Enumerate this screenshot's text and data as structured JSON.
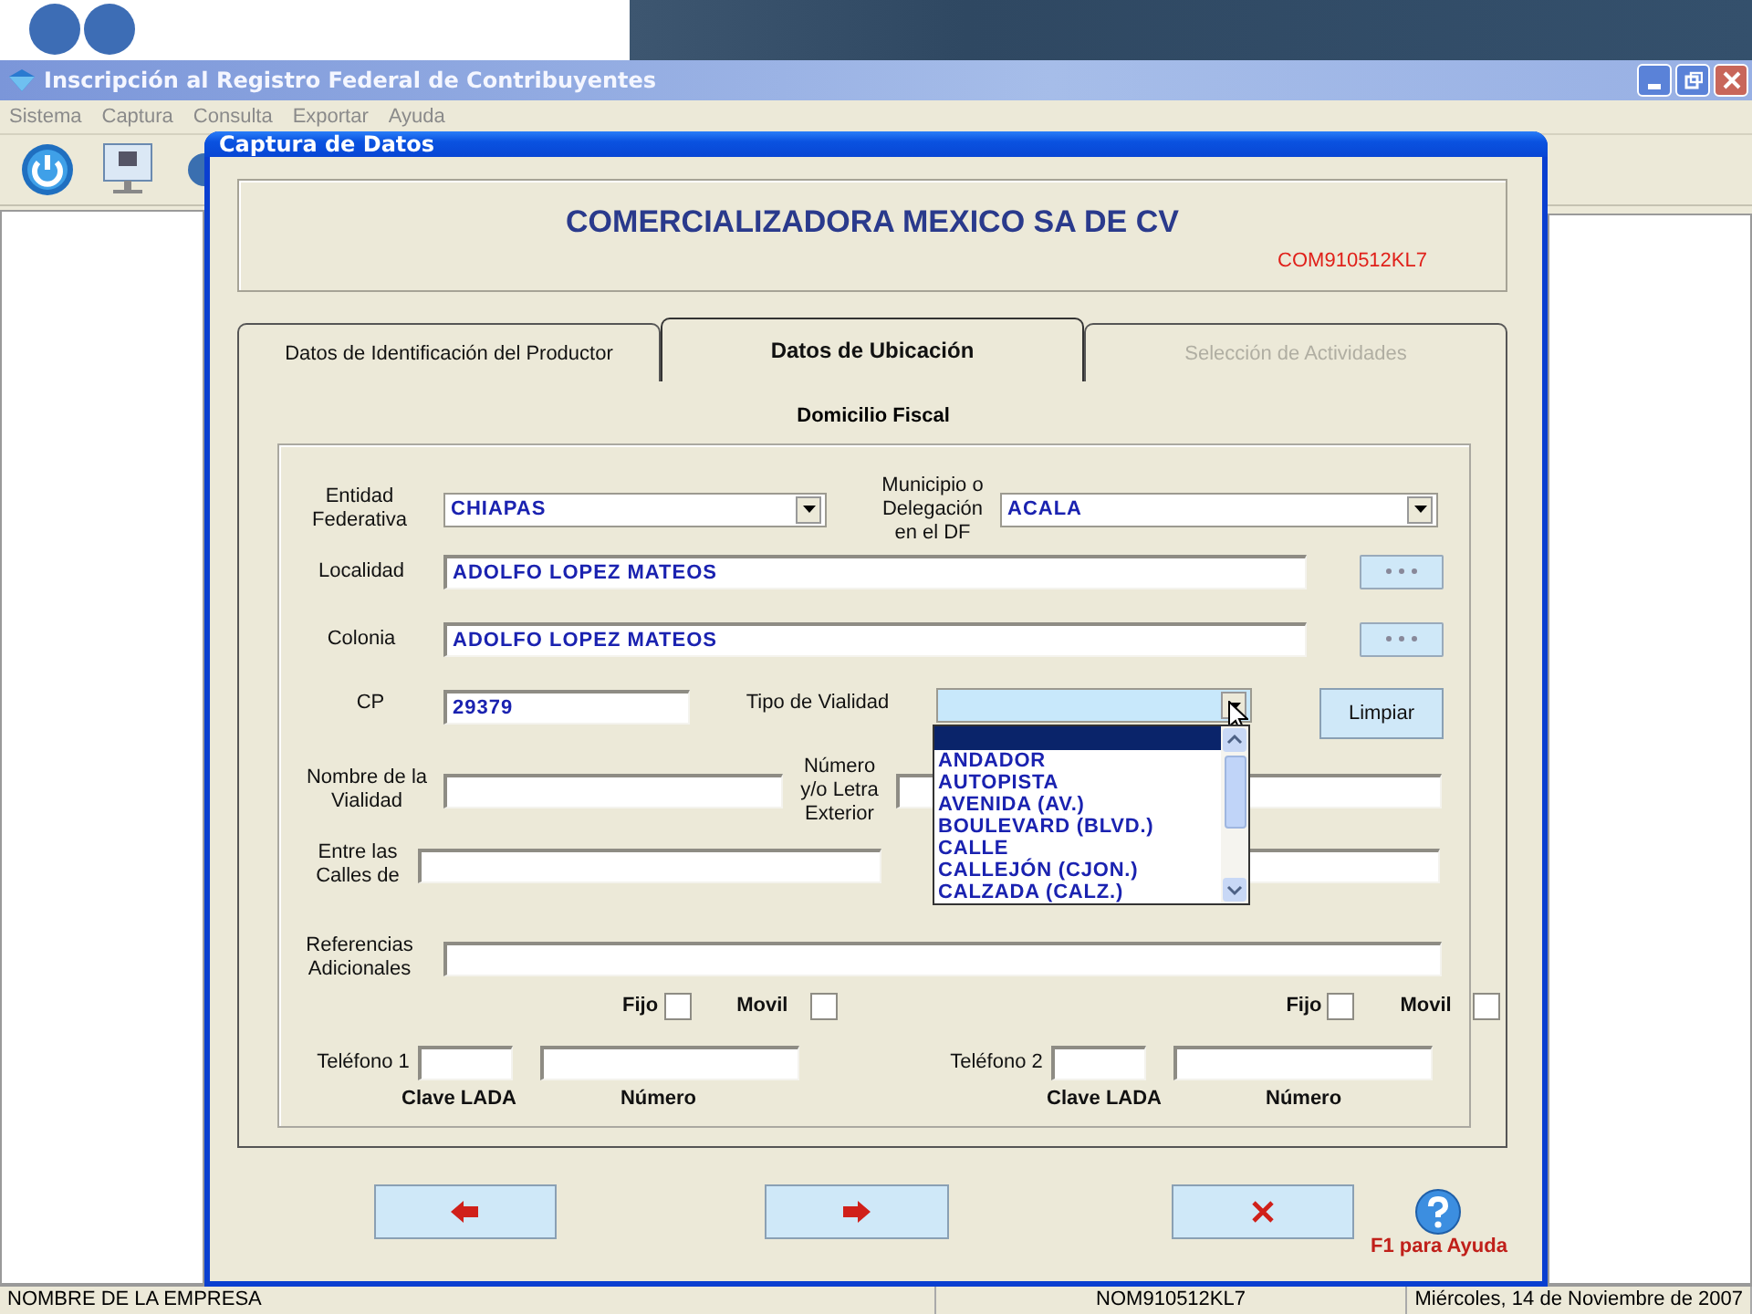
{
  "window": {
    "title": "Inscripción al Registro Federal de Contribuyentes"
  },
  "menu": [
    {
      "label": "Sistema",
      "disabled": true
    },
    {
      "label": "Captura",
      "disabled": true
    },
    {
      "label": "Consulta",
      "disabled": true
    },
    {
      "label": "Exportar",
      "disabled": true
    },
    {
      "label": "Ayuda",
      "disabled": true
    }
  ],
  "dialog": {
    "title": "Captura de Datos",
    "company": "COMERCIALIZADORA MEXICO SA DE CV",
    "rfc": "COM910512KL7",
    "tabs": [
      {
        "label": "Datos de Identificación del Productor",
        "selected": false,
        "disabled": false
      },
      {
        "label": "Datos de Ubicación",
        "selected": true,
        "disabled": false
      },
      {
        "label": "Selección de Actividades",
        "selected": false,
        "disabled": true
      }
    ],
    "section_title": "Domicilio Fiscal",
    "entidad": {
      "label": "Entidad Federativa",
      "value": "CHIAPAS"
    },
    "municipio": {
      "label": "Municipio o Delegación en el DF",
      "value": "ACALA"
    },
    "localidad": {
      "label": "Localidad",
      "value": "ADOLFO LOPEZ MATEOS"
    },
    "colonia": {
      "label": "Colonia",
      "value": "ADOLFO LOPEZ MATEOS"
    },
    "cp": {
      "label": "CP",
      "value": "29379"
    },
    "tipo_vialidad": {
      "label": "Tipo de Vialidad",
      "expanded": true,
      "blank_option_selected": true,
      "options": [
        {
          "label": "ANDADOR",
          "selected": false
        },
        {
          "label": "AUTOPISTA",
          "selected": false
        },
        {
          "label": "AVENIDA (AV.)",
          "selected": false
        },
        {
          "label": "BOULEVARD (BLVD.)",
          "selected": false
        },
        {
          "label": "CALLE",
          "selected": false
        },
        {
          "label": "CALLEJÓN (CJON.)",
          "selected": false
        },
        {
          "label": "CALZADA (CALZ.)",
          "selected": false
        }
      ]
    },
    "clear_button": "Limpiar",
    "nombre_vialidad": {
      "label": "Nombre de la Vialidad"
    },
    "numero_exterior": {
      "label": "Número y/o Letra Exterior"
    },
    "entre_calles": {
      "label": "Entre las Calles de"
    },
    "referencias": {
      "label": "Referencias Adicionales"
    },
    "phones": [
      {
        "label": "Teléfono 1",
        "fijo_label": "Fijo",
        "fijo_checked": false,
        "movil_label": "Movil",
        "movil_checked": false,
        "lada_caption": "Clave LADA",
        "numero_caption": "Número"
      },
      {
        "label": "Teléfono 2",
        "fijo_label": "Fijo",
        "fijo_checked": false,
        "movil_label": "Movil",
        "movil_checked": false,
        "lada_caption": "Clave LADA",
        "numero_caption": "Número"
      }
    ],
    "buttons": [
      {
        "kind": "back"
      },
      {
        "kind": "next"
      },
      {
        "kind": "cancel"
      }
    ],
    "help": "F1 para Ayuda"
  },
  "status_bar": [
    "NOMBRE DE LA EMPRESA",
    "NOM910512KL7",
    "Miércoles, 14 de Noviembre de 2007"
  ]
}
